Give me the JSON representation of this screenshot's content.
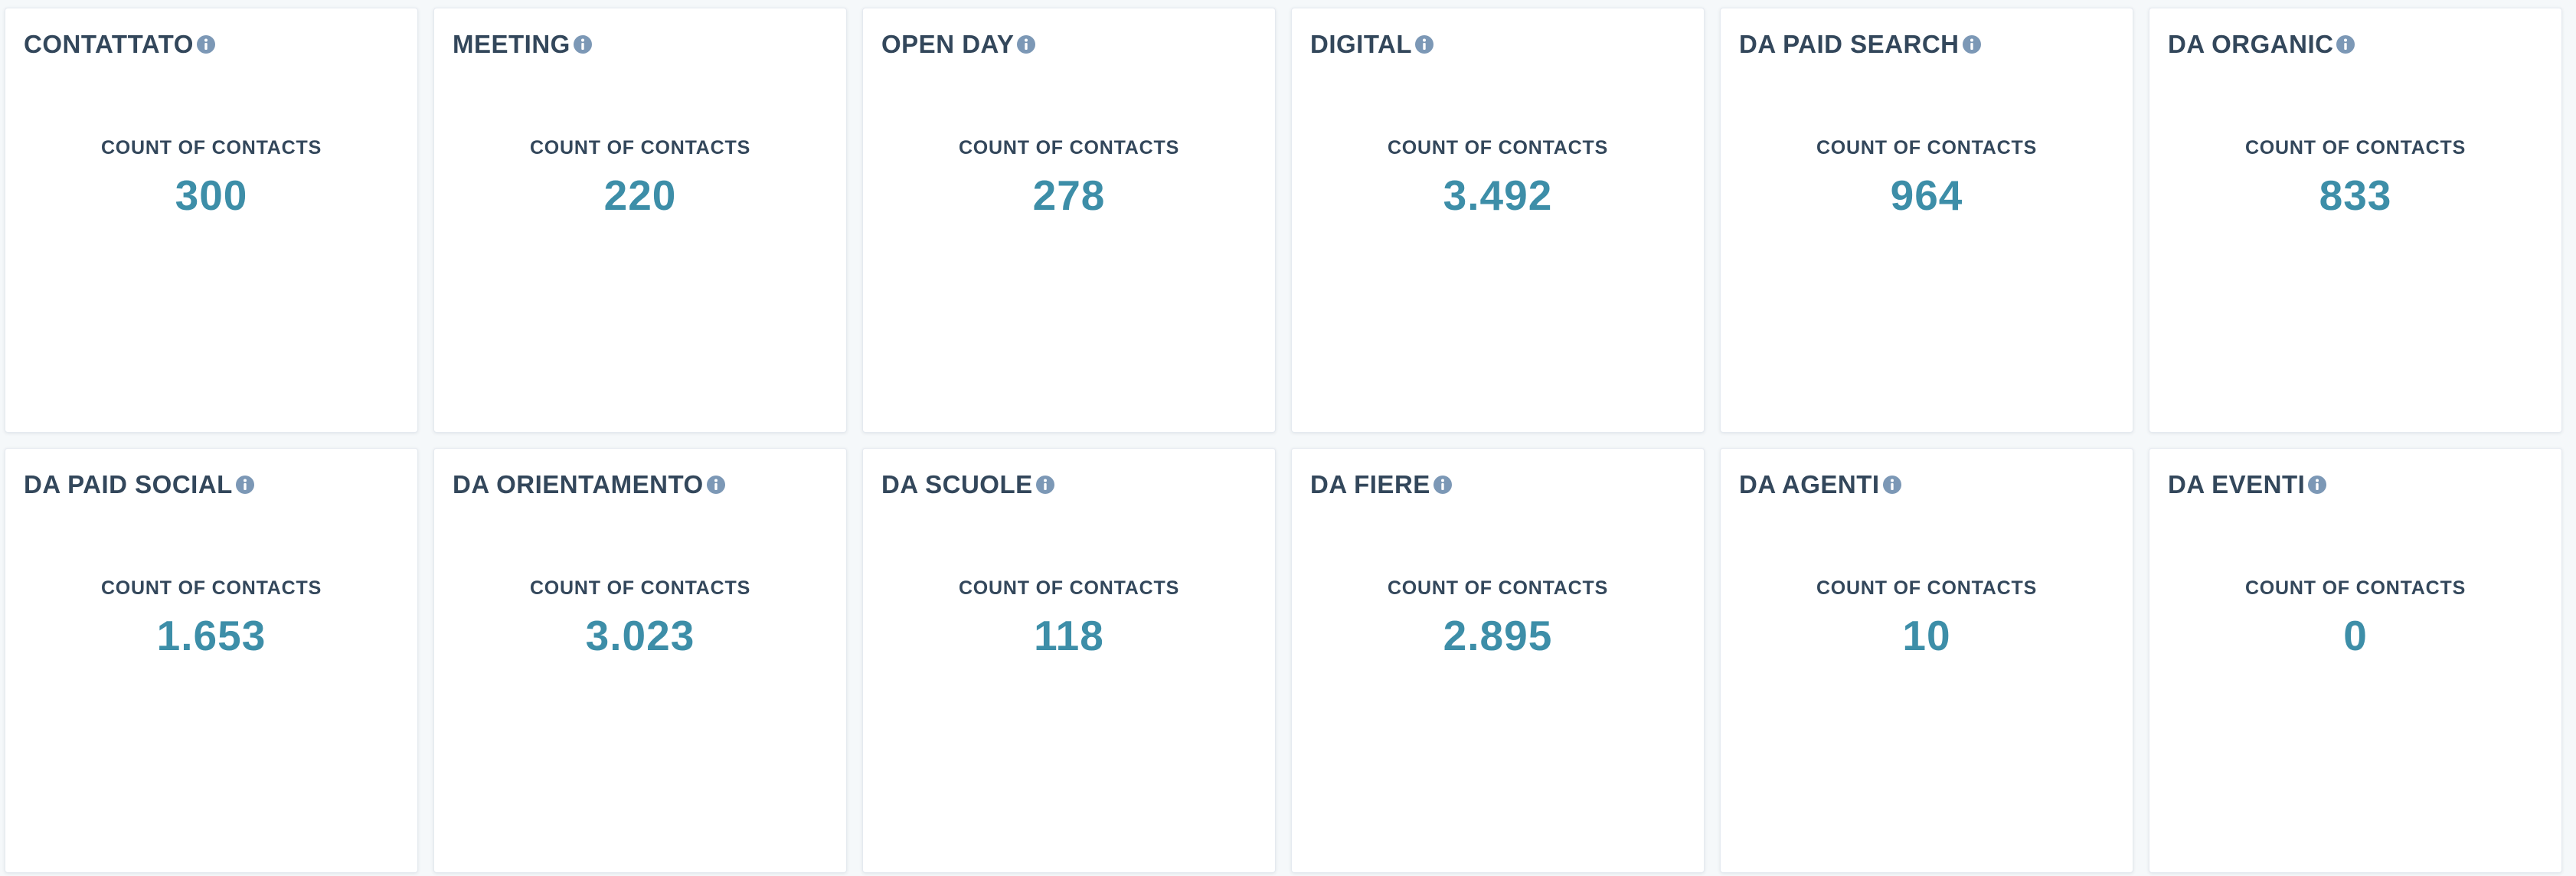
{
  "colors": {
    "background": "#f5f8fa",
    "card": "#ffffff",
    "title": "#33475b",
    "value": "#3d8ea8",
    "info_icon": "#7c98b6"
  },
  "cards": [
    {
      "title": "CONTATTATO",
      "metric_label": "COUNT OF CONTACTS",
      "value": "300",
      "icon": "info-icon"
    },
    {
      "title": "MEETING",
      "metric_label": "COUNT OF CONTACTS",
      "value": "220",
      "icon": "info-icon"
    },
    {
      "title": "OPEN DAY",
      "metric_label": "COUNT OF CONTACTS",
      "value": "278",
      "icon": "info-icon"
    },
    {
      "title": "DIGITAL",
      "metric_label": "COUNT OF CONTACTS",
      "value": "3.492",
      "icon": "info-icon"
    },
    {
      "title": "DA PAID SEARCH",
      "metric_label": "COUNT OF CONTACTS",
      "value": "964",
      "icon": "info-icon"
    },
    {
      "title": "DA ORGANIC",
      "metric_label": "COUNT OF CONTACTS",
      "value": "833",
      "icon": "info-icon"
    },
    {
      "title": "DA PAID SOCIAL",
      "metric_label": "COUNT OF CONTACTS",
      "value": "1.653",
      "icon": "info-icon"
    },
    {
      "title": "DA ORIENTAMENTO",
      "metric_label": "COUNT OF CONTACTS",
      "value": "3.023",
      "icon": "info-icon"
    },
    {
      "title": "DA SCUOLE",
      "metric_label": "COUNT OF CONTACTS",
      "value": "118",
      "icon": "info-icon"
    },
    {
      "title": "DA FIERE",
      "metric_label": "COUNT OF CONTACTS",
      "value": "2.895",
      "icon": "info-icon"
    },
    {
      "title": "DA AGENTI",
      "metric_label": "COUNT OF CONTACTS",
      "value": "10",
      "icon": "info-icon"
    },
    {
      "title": "DA EVENTI",
      "metric_label": "COUNT OF CONTACTS",
      "value": "0",
      "icon": "info-icon"
    }
  ]
}
